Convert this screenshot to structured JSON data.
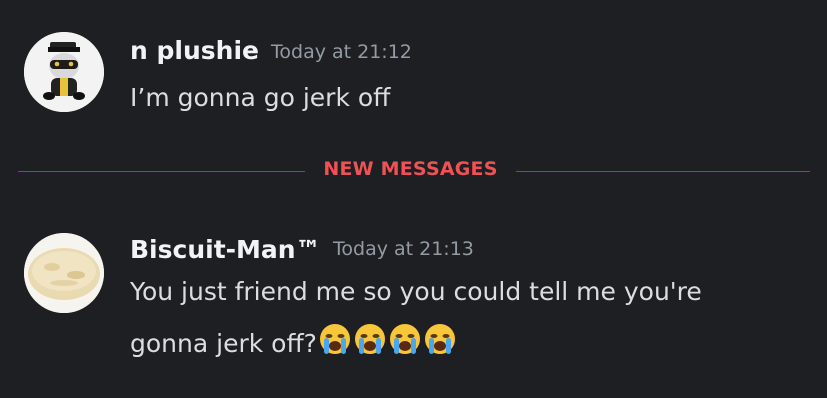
{
  "messages": [
    {
      "author": "n plushie",
      "timestamp": "Today at 21:12",
      "text": "I’m gonna go jerk off",
      "avatar_icon": "plush-toy-avatar"
    },
    {
      "author": "Biscuit-Man™",
      "timestamp": "Today at 21:13",
      "text_line1": "You just friend me so you could tell me you're",
      "text_line2": "gonna jerk off?",
      "emojis": [
        "loudly-crying-face",
        "loudly-crying-face",
        "loudly-crying-face",
        "loudly-crying-face"
      ],
      "avatar_icon": "biscuit-avatar"
    }
  ],
  "divider": {
    "label": "NEW MESSAGES",
    "color": "#ed5355"
  },
  "colors": {
    "background": "#1e1f22",
    "author": "#f2f3f5",
    "timestamp": "#949ba4",
    "text": "#dbdee1"
  }
}
